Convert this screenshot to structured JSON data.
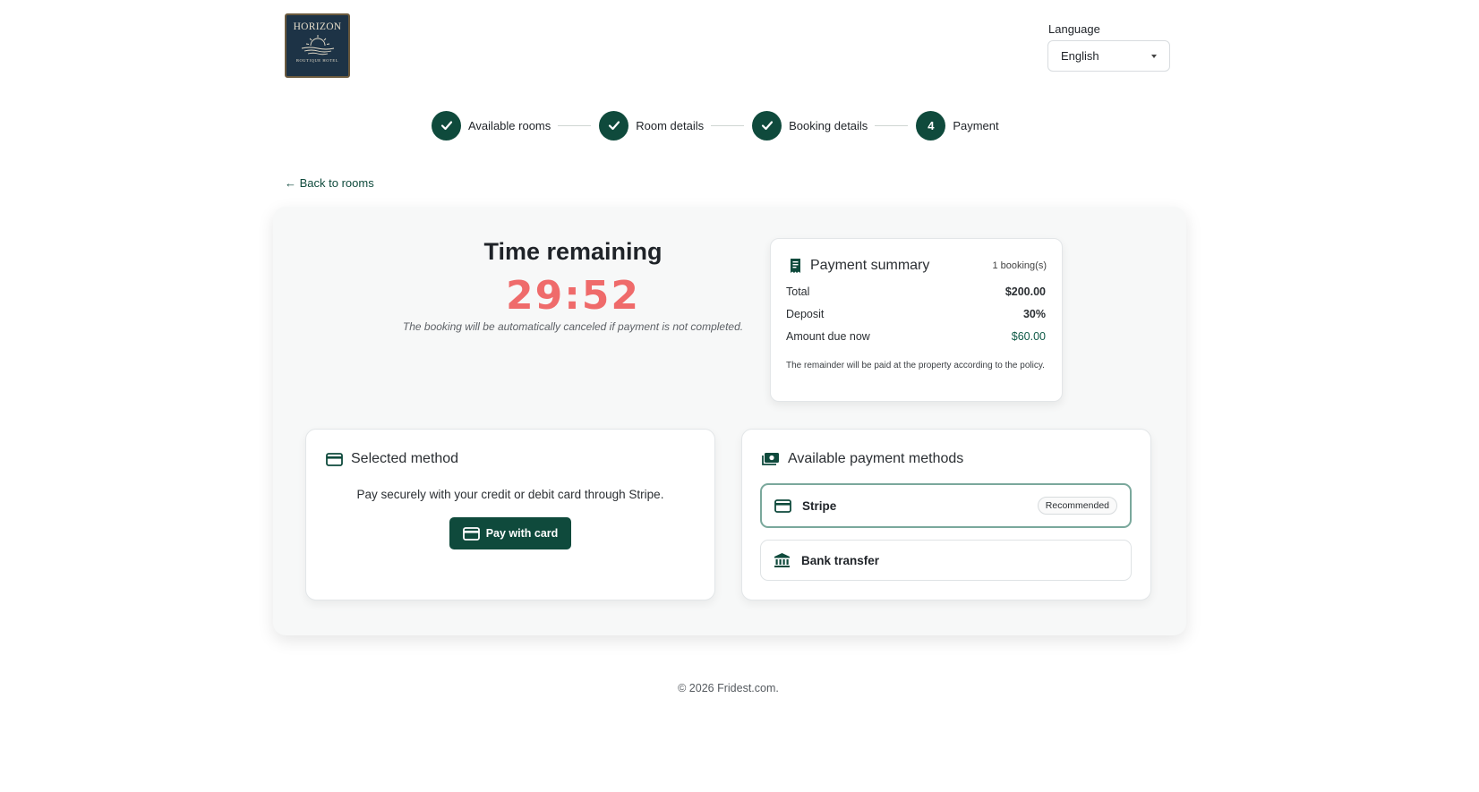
{
  "header": {
    "logo": {
      "brand": "HORIZON",
      "tagline": "BOUTIQUE HOTEL"
    },
    "language": {
      "label": "Language",
      "selected": "English"
    }
  },
  "steps": [
    {
      "label": "Available rooms",
      "status": "done"
    },
    {
      "label": "Room details",
      "status": "done"
    },
    {
      "label": "Booking details",
      "status": "done"
    },
    {
      "number": "4",
      "label": "Payment",
      "status": "current"
    }
  ],
  "back_link": "← Back to rooms",
  "timer": {
    "title": "Time remaining",
    "value": "29:52",
    "note": "The booking will be automatically canceled if payment is not completed."
  },
  "summary": {
    "title": "Payment summary",
    "count": "1 booking(s)",
    "rows": [
      {
        "label": "Total",
        "value": "$200.00"
      },
      {
        "label": "Deposit",
        "value": "30%"
      },
      {
        "label": "Amount due now",
        "value": "$60.00"
      }
    ],
    "note": "The remainder will be paid at the property according to the policy."
  },
  "selected_method": {
    "title": "Selected method",
    "description": "Pay securely with your credit or debit card through Stripe.",
    "button": "Pay with card"
  },
  "available_methods": {
    "title": "Available payment methods",
    "methods": [
      {
        "label": "Stripe",
        "badge": "Recommended"
      },
      {
        "label": "Bank transfer"
      }
    ]
  },
  "footer": "© 2026 Fridest.com.",
  "colors": {
    "primary": "#0f4a3c",
    "timer": "#ef6b6b",
    "accent_border": "#7aa89c"
  }
}
